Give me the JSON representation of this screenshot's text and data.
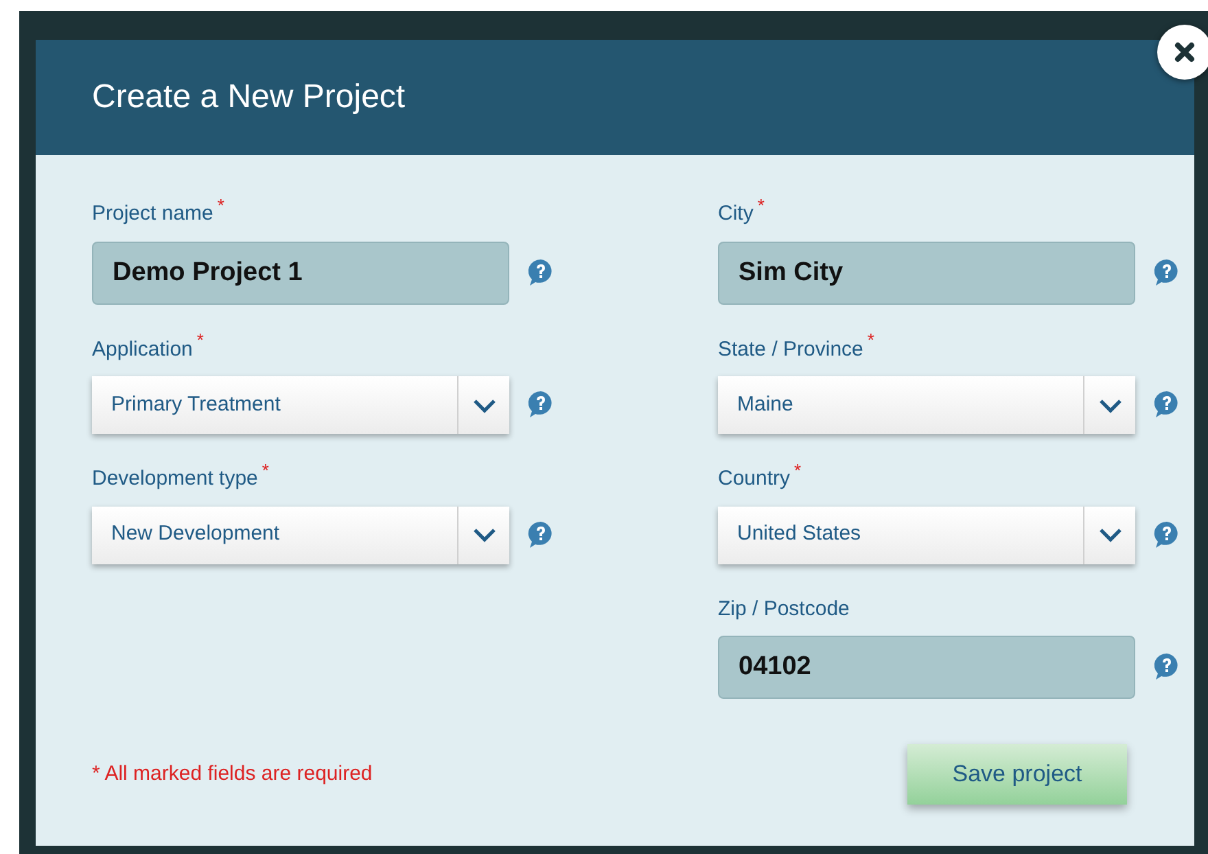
{
  "dialog": {
    "title": "Create a New Project"
  },
  "columns": [
    [
      {
        "kind": "text",
        "label": "Project name",
        "required": true,
        "value": "Demo Project 1"
      },
      {
        "kind": "select",
        "label": "Application",
        "required": true,
        "value": "Primary Treatment"
      },
      {
        "kind": "select",
        "label": "Development type",
        "required": true,
        "value": "New Development"
      }
    ],
    [
      {
        "kind": "text",
        "label": "City",
        "required": true,
        "value": "Sim City"
      },
      {
        "kind": "select",
        "label": "State / Province",
        "required": true,
        "value": "Maine"
      },
      {
        "kind": "select",
        "label": "Country",
        "required": true,
        "value": "United States"
      },
      {
        "kind": "text",
        "label": "Zip / Postcode",
        "required": false,
        "value": "04102"
      }
    ]
  ],
  "required_note": {
    "mark": "*",
    "text": "All marked fields are required"
  },
  "save_button": "Save project"
}
